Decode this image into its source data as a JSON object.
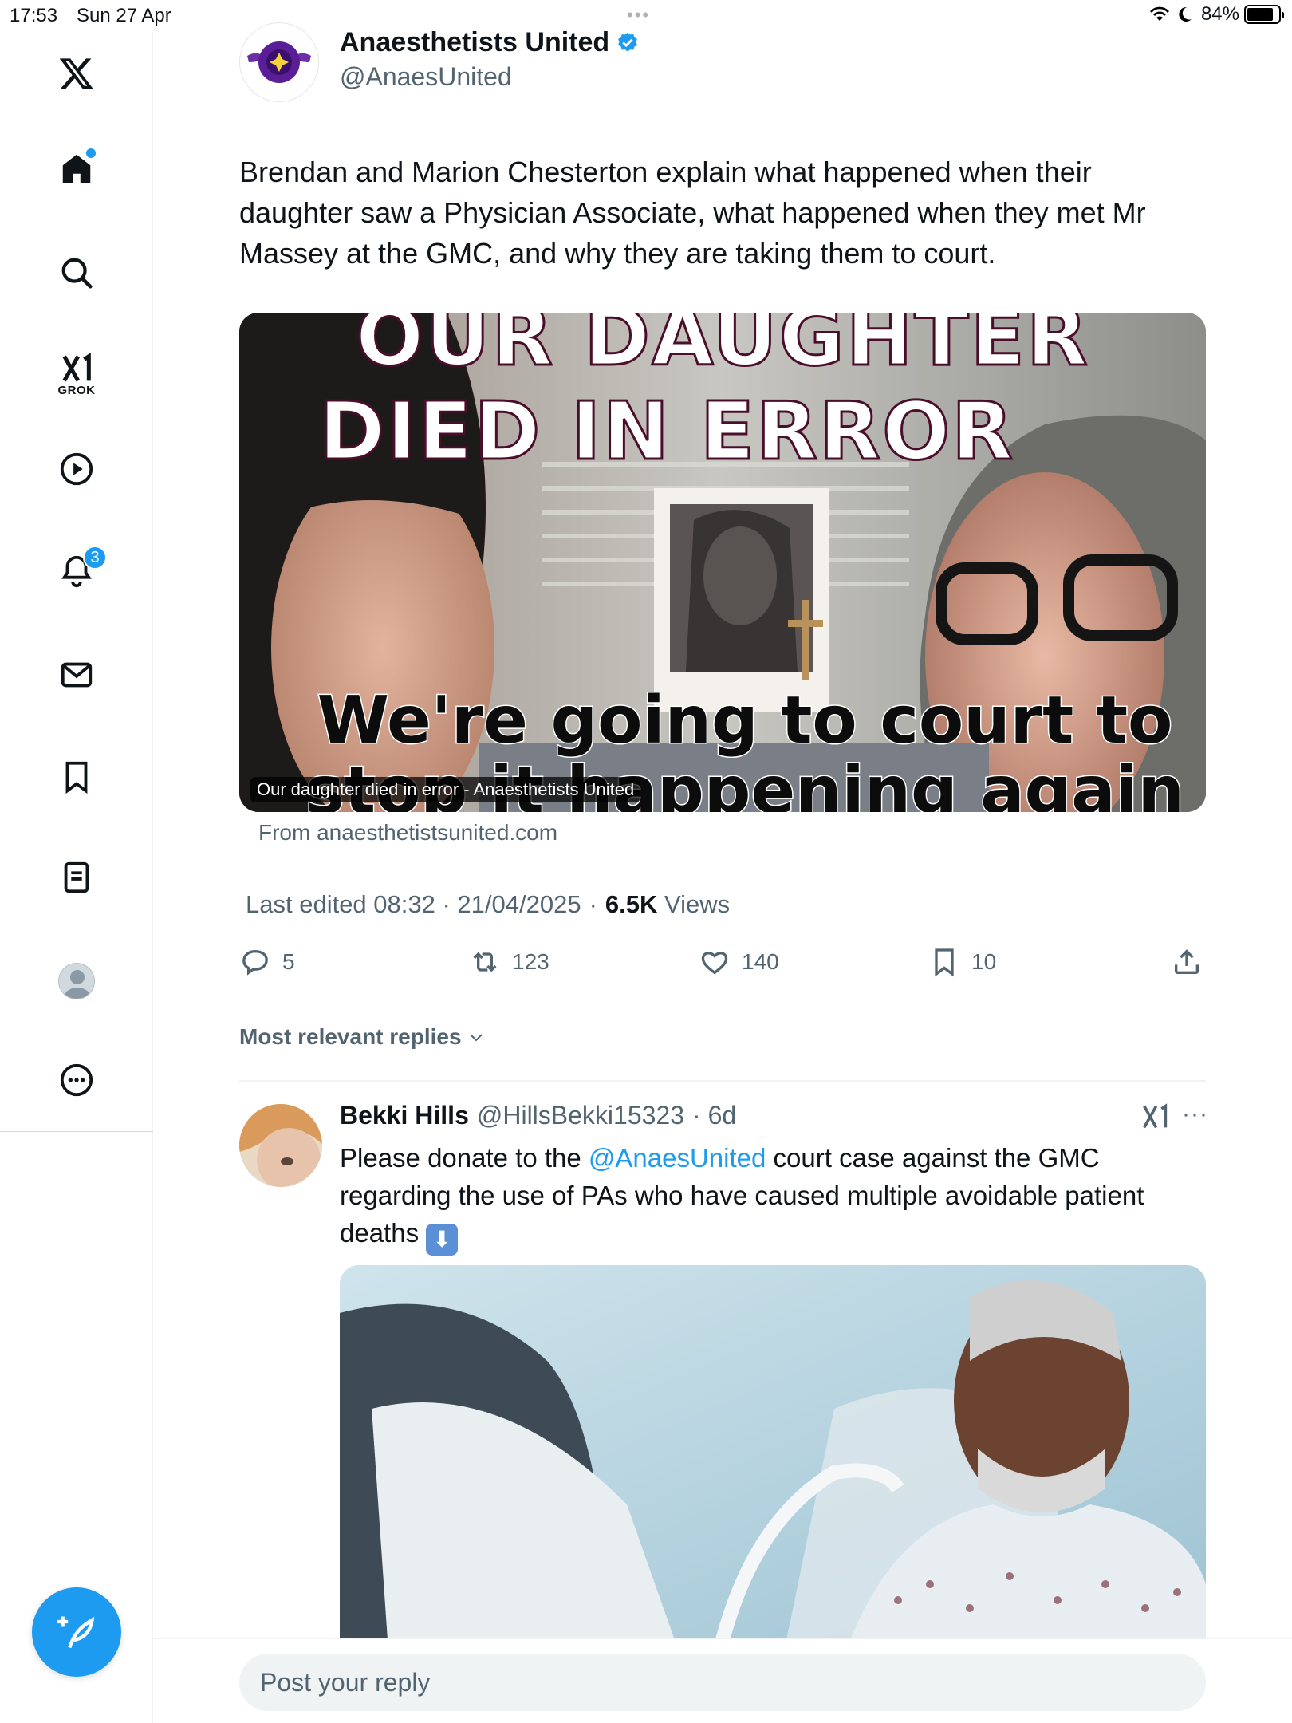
{
  "status_bar": {
    "time": "17:53",
    "date": "Sun 27 Apr",
    "battery": "84%",
    "battery_level": 0.84
  },
  "sidebar": {
    "grok_label": "GROK",
    "notifications_badge": "3"
  },
  "tweet": {
    "author_name": "Anaesthetists United",
    "author_handle": "@AnaesUnited",
    "text": "Brendan and Marion Chesterton  explain what happened when their daughter saw a Physician Associate, what happened when they met Mr Massey at the GMC, and why they are taking them to court.",
    "card": {
      "headline_line1": "OUR DAUGHTER",
      "headline_line2": "DIED IN ERROR",
      "subhead_line1": "We're going to court to",
      "subhead_line2": "stop it happening again",
      "caption": "Our daughter died in error - Anaesthetists United",
      "source": "From anaesthetistsunited.com"
    },
    "meta": {
      "edited": "Last edited 08:32 · 21/04/2025",
      "views_count": "6.5K",
      "views_label": "Views"
    },
    "stats": {
      "replies": "5",
      "reposts": "123",
      "likes": "140",
      "bookmarks": "10"
    }
  },
  "replies_sort": "Most relevant replies",
  "reply": {
    "name": "Bekki Hills",
    "handle": "@HillsBekki15323",
    "time": "· 6d",
    "text_before": "Please donate to the ",
    "mention": "@AnaesUnited",
    "text_after": "  court case against the GMC regarding the use of PAs who have caused multiple avoidable patient deaths "
  },
  "reply_box": {
    "placeholder": "Post your reply"
  },
  "colors": {
    "accent": "#1d9bf0",
    "text": "#0f1419",
    "secondary": "#536471"
  }
}
